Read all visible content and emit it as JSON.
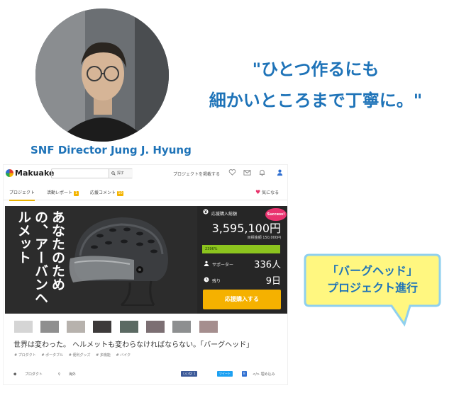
{
  "director_caption": "SNF Director Jung J. Hyung",
  "quote": [
    "\"ひとつ作るにも",
    "細かいところまで丁寧に。\""
  ],
  "bubble": [
    "「バーグヘッド」",
    "プロジェクト進行"
  ],
  "makuake": {
    "brand": "Makuake",
    "search_button": "探す",
    "post_project": "プロジェクトを掲載する",
    "tabs": [
      {
        "label": "プロジェクト",
        "count": ""
      },
      {
        "label": "活動レポート",
        "count": "1"
      },
      {
        "label": "応援コメント",
        "count": "10"
      }
    ],
    "favorite": "気になる",
    "hero_text": "あなたのための、アーバンヘルメット",
    "total_label": "応援購入総額",
    "total_amount": "3,595,100円",
    "goal": "目標金額 150,000円",
    "success_badge": "Success!",
    "progress_text": "2396%",
    "progress_percent": 2396,
    "supporters_label": "サポーター",
    "supporters_value": "336人",
    "remaining_label": "残り",
    "remaining_value": "9日",
    "cta": "応援購入する",
    "project_title": "世界は変わった。 ヘルメットも変わらなければならない。「バーグヘッド」",
    "tags": [
      "# プロダクト",
      "# ポータブル",
      "# 便利グッズ",
      "# 多機能",
      "# バイク"
    ],
    "category": "プロダクト",
    "location": "海外",
    "share_like": "いいね! 1",
    "share_tweet": "ツイート",
    "embed": "埋め込み"
  },
  "colors": {
    "accent_blue": "#1e73b8",
    "cta_yellow": "#f5b100",
    "success_pink": "#e9336f",
    "progress_green": "#8cc41e",
    "bubble_fill": "#fff780"
  },
  "icons": [
    "search-icon",
    "heart-icon",
    "mail-icon",
    "bell-icon",
    "user-icon",
    "yen-icon",
    "person-icon",
    "clock-icon",
    "tag-icon",
    "pin-icon"
  ]
}
